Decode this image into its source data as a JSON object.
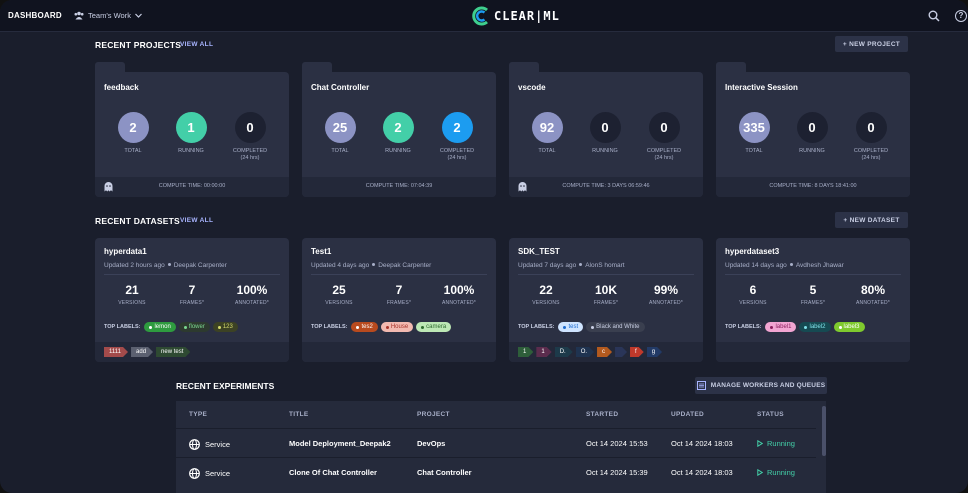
{
  "topbar": {
    "title": "DASHBOARD",
    "workspace": "Team's Work",
    "logo_text": "CLEAR|ML",
    "colors": {
      "logo_green": "#3ecf8e",
      "logo_blue": "#1c9cf0"
    }
  },
  "projects_section": {
    "title": "RECENT PROJECTS",
    "view_all": "VIEW ALL",
    "new_button": "+ NEW PROJECT",
    "projects": [
      {
        "name": "feedback",
        "total": "2",
        "running": "1",
        "completed": "0",
        "total_label": "TOTAL",
        "running_label": "RUNNING",
        "completed_label": "COMPLETED",
        "completed_sub": "(24 hrs)",
        "compute_time": "COMPUTE TIME: 00:00:00",
        "has_ghost": true
      },
      {
        "name": "Chat Controller",
        "total": "25",
        "running": "2",
        "completed": "2",
        "total_label": "TOTAL",
        "running_label": "RUNNING",
        "completed_label": "COMPLETED",
        "completed_sub": "(24 hrs)",
        "compute_time": "COMPUTE TIME: 07:04:39",
        "has_ghost": false
      },
      {
        "name": "vscode",
        "total": "92",
        "running": "0",
        "completed": "0",
        "total_label": "TOTAL",
        "running_label": "RUNNING",
        "completed_label": "COMPLETED",
        "completed_sub": "(24 hrs)",
        "compute_time": "COMPUTE TIME: 3 DAYS 06:59:46",
        "has_ghost": true
      },
      {
        "name": "Interactive Session",
        "total": "335",
        "running": "0",
        "completed": "0",
        "total_label": "TOTAL",
        "running_label": "RUNNING",
        "completed_label": "COMPLETED",
        "completed_sub": "(24 hrs)",
        "compute_time": "COMPUTE TIME: 8 DAYS 18:41:00",
        "has_ghost": false
      }
    ]
  },
  "datasets_section": {
    "title": "RECENT DATASETS",
    "view_all": "VIEW ALL",
    "new_button": "+ NEW DATASET",
    "datasets": [
      {
        "name": "hyperdata1",
        "updated": "Updated 2 hours ago",
        "owner": "Deepak Carpenter",
        "versions": "21",
        "frames": "7",
        "annotated": "100%",
        "versions_label": "VERSIONS",
        "frames_label": "FRAMES*",
        "annotated_label": "ANNOTATED*",
        "top_labels_title": "TOP LABELS:",
        "labels": [
          {
            "text": "lemon",
            "color": "#2e9b3f"
          },
          {
            "text": "flower",
            "color": "#2d3a2f",
            "fg": "#7bd88f"
          },
          {
            "text": "123",
            "color": "#3c4224",
            "fg": "#d3d96b"
          }
        ],
        "tags": [
          {
            "text": "1111",
            "color": "#a34b4b"
          },
          {
            "text": "add",
            "color": "#5b6070"
          },
          {
            "text": "new test",
            "color": "#2e4a32"
          }
        ]
      },
      {
        "name": "Test1",
        "updated": "Updated 4 days ago",
        "owner": "Deepak Carpenter",
        "versions": "25",
        "frames": "7",
        "annotated": "100%",
        "versions_label": "VERSIONS",
        "frames_label": "FRAMES*",
        "annotated_label": "ANNOTATED*",
        "top_labels_title": "TOP LABELS:",
        "labels": [
          {
            "text": "tes2",
            "color": "#b84a1e"
          },
          {
            "text": "House",
            "color": "#f2b9b0",
            "fg": "#a8332a"
          },
          {
            "text": "camera",
            "color": "#bde8b5",
            "fg": "#2e6b2f"
          }
        ],
        "tags": []
      },
      {
        "name": "SDK_TEST",
        "updated": "Updated 7 days ago",
        "owner": "AlonS homart",
        "versions": "22",
        "frames": "10K",
        "annotated": "99%",
        "versions_label": "VERSIONS",
        "frames_label": "FRAMES*",
        "annotated_label": "ANNOTATED*",
        "top_labels_title": "TOP LABELS:",
        "labels": [
          {
            "text": "test",
            "color": "#cfe4ff",
            "fg": "#1c6bd0"
          },
          {
            "text": "Black and White",
            "color": "#3a3f4f",
            "fg": "#c9cfe4"
          }
        ],
        "tags": [
          {
            "text": "1",
            "color": "#2e5e3a"
          },
          {
            "text": "1",
            "color": "#5b2c4d"
          },
          {
            "text": "D.",
            "color": "#1d3a4a"
          },
          {
            "text": "O.",
            "color": "#1f3350"
          },
          {
            "text": "c",
            "color": "#b35a1e"
          },
          {
            "text": "",
            "color": "#2a3558"
          },
          {
            "text": "f",
            "color": "#c0392b"
          },
          {
            "text": "g",
            "color": "#223a66"
          }
        ]
      },
      {
        "name": "hyperdataset3",
        "updated": "Updated 14 days ago",
        "owner": "Avdhesh Jhawar",
        "versions": "6",
        "frames": "5",
        "annotated": "80%",
        "versions_label": "VERSIONS",
        "frames_label": "FRAMES*",
        "annotated_label": "ANNOTATED*",
        "top_labels_title": "TOP LABELS:",
        "labels": [
          {
            "text": "label1",
            "color": "#f2a5d2",
            "fg": "#8c1f5e"
          },
          {
            "text": "label2",
            "color": "#164a52",
            "fg": "#7fe0e8"
          },
          {
            "text": "label3",
            "color": "#7fca2e"
          }
        ],
        "tags": []
      }
    ]
  },
  "experiments_section": {
    "title": "RECENT EXPERIMENTS",
    "manage_button": "MANAGE WORKERS AND QUEUES",
    "columns": [
      "TYPE",
      "TITLE",
      "PROJECT",
      "STARTED",
      "UPDATED",
      "STATUS"
    ],
    "rows": [
      {
        "type": "Service",
        "title": "Model Deployment_Deepak2",
        "project": "DevOps",
        "started": "Oct 14 2024 15:53",
        "updated": "Oct 14 2024 18:03",
        "status": "Running"
      },
      {
        "type": "Service",
        "title": "Clone Of Chat Controller",
        "project": "Chat Controller",
        "started": "Oct 14 2024 15:39",
        "updated": "Oct 14 2024 18:03",
        "status": "Running"
      }
    ]
  }
}
